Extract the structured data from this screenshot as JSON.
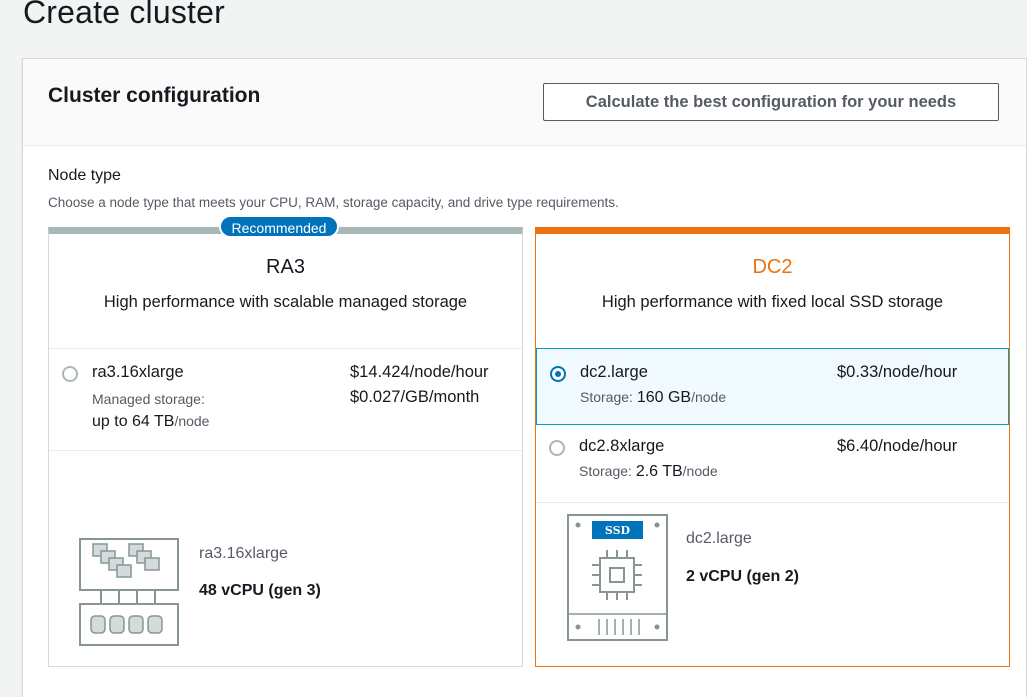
{
  "page": {
    "title": "Create cluster"
  },
  "panel": {
    "title": "Cluster configuration",
    "calc_button": "Calculate the best configuration for your needs"
  },
  "node_type": {
    "label": "Node type",
    "description": "Choose a node type that meets your CPU, RAM, storage capacity, and drive type requirements."
  },
  "cards": {
    "ra3": {
      "badge": "Recommended",
      "name": "RA3",
      "subtitle": "High performance with scalable managed storage",
      "options": [
        {
          "name": "ra3.16xlarge",
          "price": "$14.424/node/hour",
          "storage_label": "Managed storage:",
          "storage_price": "$0.027/GB/month",
          "storage_value": "up to 64 TB",
          "storage_unit": "/node",
          "selected": false
        }
      ],
      "spec": {
        "name": "ra3.16xlarge",
        "cpu": "48 vCPU (gen 3)"
      }
    },
    "dc2": {
      "name": "DC2",
      "subtitle": "High performance with fixed local SSD storage",
      "options": [
        {
          "name": "dc2.large",
          "price": "$0.33/node/hour",
          "storage_label": "Storage:",
          "storage_value": "160 GB",
          "storage_unit": "/node",
          "selected": true
        },
        {
          "name": "dc2.8xlarge",
          "price": "$6.40/node/hour",
          "storage_label": "Storage:",
          "storage_value": "2.6 TB",
          "storage_unit": "/node",
          "selected": false
        }
      ],
      "spec": {
        "name": "dc2.large",
        "cpu": "2 vCPU (gen 2)",
        "ssd_label": "SSD"
      }
    }
  },
  "colors": {
    "accent_orange": "#ec7211",
    "selected_blue": "#0073bb",
    "badge_blue": "#0073bb"
  },
  "icons": [
    "managed-storage-server-icon",
    "ssd-chip-icon"
  ]
}
